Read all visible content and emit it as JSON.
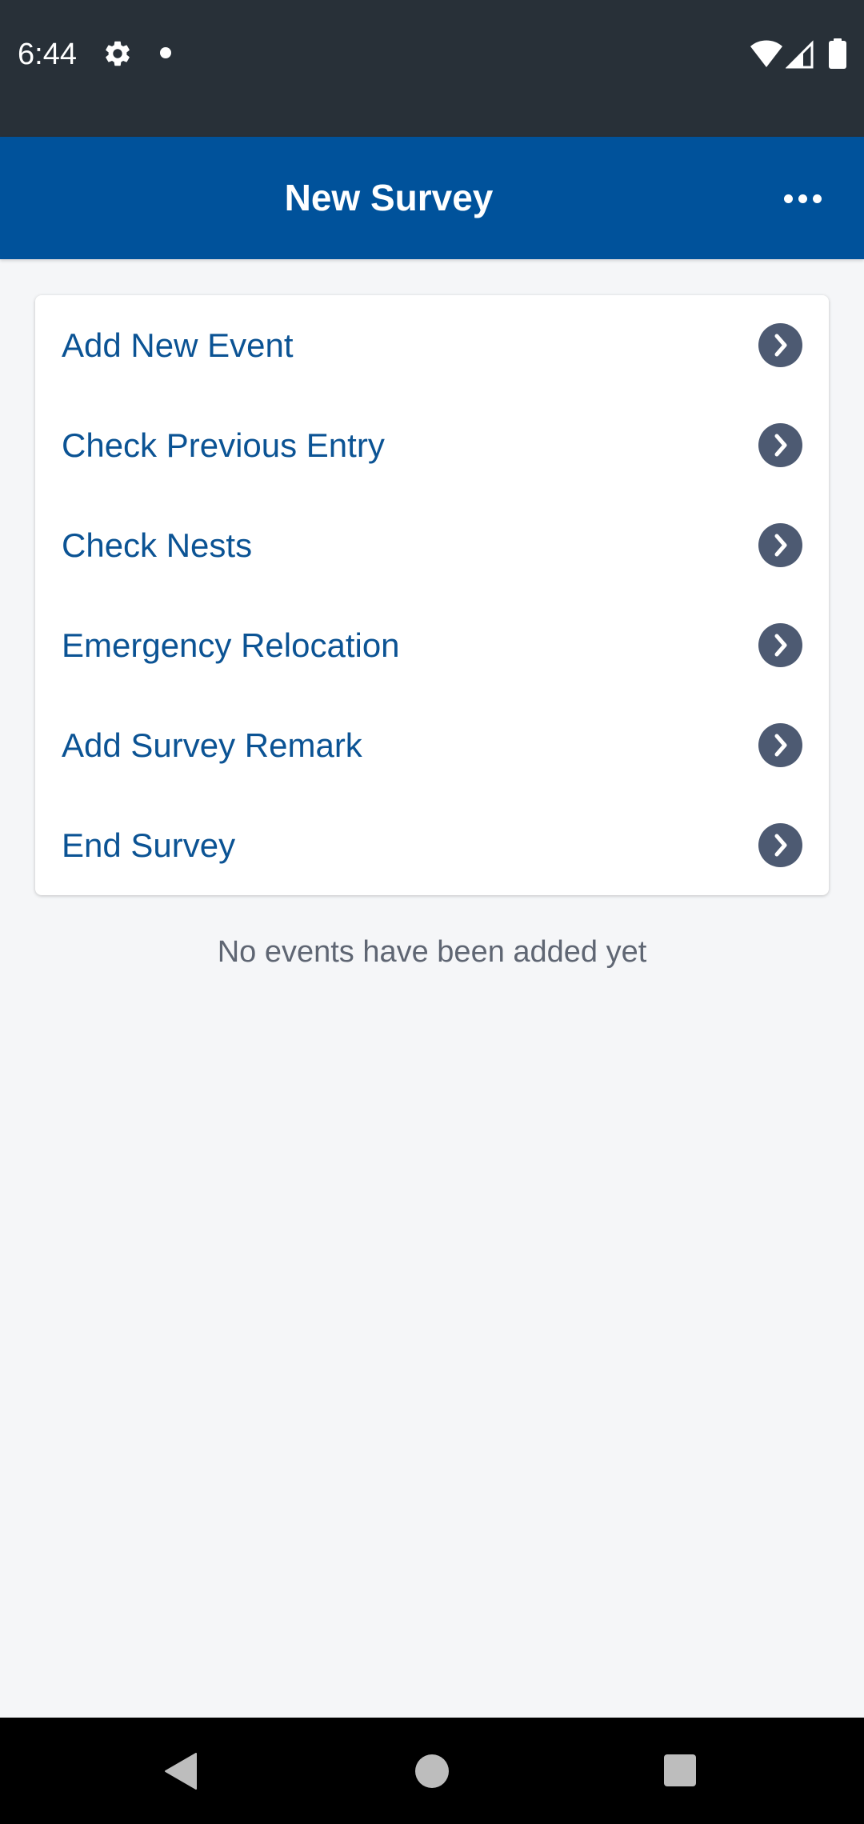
{
  "status_bar": {
    "time": "6:44",
    "icons": [
      "settings-icon",
      "notification-dot-icon",
      "wifi-icon",
      "cell-signal-icon",
      "battery-icon"
    ]
  },
  "header": {
    "title": "New Survey",
    "more_icon": "more-horizontal-icon"
  },
  "menu": {
    "items": [
      {
        "label": "Add New Event",
        "icon": "chevron-right-icon"
      },
      {
        "label": "Check Previous Entry",
        "icon": "chevron-right-icon"
      },
      {
        "label": "Check Nests",
        "icon": "chevron-right-icon"
      },
      {
        "label": "Emergency Relocation",
        "icon": "chevron-right-icon"
      },
      {
        "label": "Add Survey Remark",
        "icon": "chevron-right-icon"
      },
      {
        "label": "End Survey",
        "icon": "chevron-right-icon"
      }
    ]
  },
  "events": {
    "empty_message": "No events have been added yet"
  },
  "nav_bar": {
    "icons": [
      "back-icon",
      "home-icon",
      "recents-icon"
    ]
  },
  "colors": {
    "status_bar_bg": "#283038",
    "header_bg": "#00529b",
    "page_bg": "#f5f6f8",
    "link_text": "#0b5394",
    "chevron_bg": "#4d5a72",
    "muted_text": "#5f6673"
  }
}
